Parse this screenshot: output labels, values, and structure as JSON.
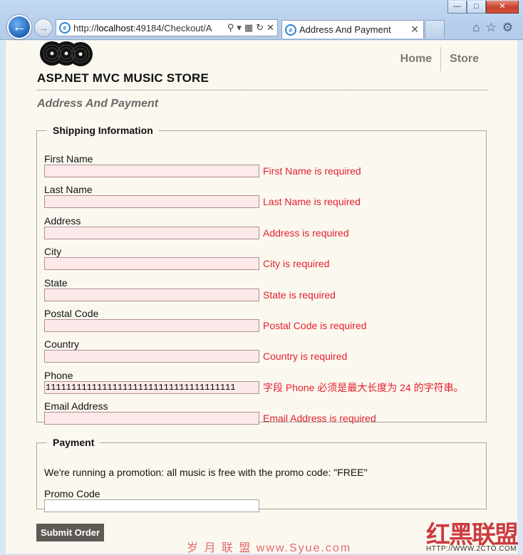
{
  "browser": {
    "url": "http://localhost:49184/Checkout/A",
    "url_prefix": "http://",
    "url_host": "localhost",
    "url_rest": ":49184/Checkout/A",
    "tab_title": "Address And Payment",
    "icons": [
      "back-arrow-icon",
      "forward-arrow-icon",
      "ie-logo-icon",
      "search-icon",
      "compatibility-icon",
      "refresh-icon",
      "stop-icon",
      "home-icon",
      "favorites-star-icon",
      "tools-gear-icon"
    ]
  },
  "site": {
    "title": "ASP.NET MVC MUSIC STORE",
    "nav": {
      "home": "Home",
      "store": "Store"
    }
  },
  "page": {
    "heading": "Address And Payment"
  },
  "shipping": {
    "legend": "Shipping Information",
    "fields": [
      {
        "label": "First Name",
        "value": "",
        "error": "First Name is required"
      },
      {
        "label": "Last Name",
        "value": "",
        "error": "Last Name is required"
      },
      {
        "label": "Address",
        "value": "",
        "error": "Address is required"
      },
      {
        "label": "City",
        "value": "",
        "error": "City is required"
      },
      {
        "label": "State",
        "value": "",
        "error": "State is required"
      },
      {
        "label": "Postal Code",
        "value": "",
        "error": "Postal Code is required"
      },
      {
        "label": "Country",
        "value": "",
        "error": "Country is required"
      },
      {
        "label": "Phone",
        "value": "1111111111111111111111111111111111111",
        "error": "字段 Phone 必须是最大长度为 24 的字符串。"
      },
      {
        "label": "Email Address",
        "value": "",
        "error": "Email Address is required"
      }
    ]
  },
  "payment": {
    "legend": "Payment",
    "promo_text": "We're running a promotion: all music is free with the promo code: \"FREE\"",
    "promo_label": "Promo Code",
    "promo_value": ""
  },
  "submit_label": "Submit Order",
  "watermarks": {
    "left": "岁 月 联 盟   www.Syue.com",
    "right": "红黑联盟",
    "right_url": "HTTP://WWW.2CTO.COM"
  },
  "colors": {
    "error": "#e4202c",
    "input_error_bg": "#fde9e9",
    "page_bg": "#fbf8f0",
    "button_bg": "#5e5a55"
  }
}
